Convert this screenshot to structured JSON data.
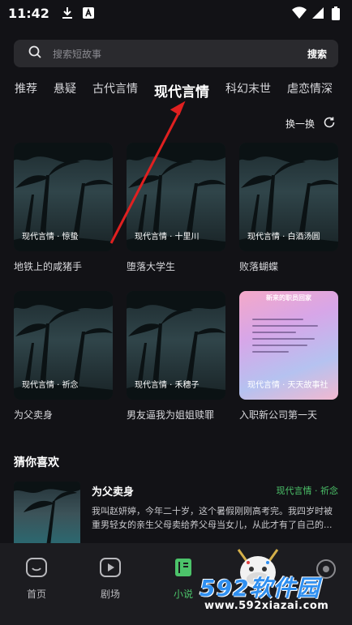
{
  "status": {
    "time": "11:42",
    "left_icons": [
      "download-icon",
      "app-a-icon"
    ],
    "right_icons": [
      "wifi-icon",
      "signal-icon",
      "battery-icon"
    ]
  },
  "search": {
    "placeholder": "搜索短故事",
    "button": "搜索"
  },
  "tabs": [
    {
      "label": "推荐",
      "active": false
    },
    {
      "label": "悬疑",
      "active": false
    },
    {
      "label": "古代言情",
      "active": false
    },
    {
      "label": "现代言情",
      "active": true
    },
    {
      "label": "科幻末世",
      "active": false
    },
    {
      "label": "虐恋情深",
      "active": false
    }
  ],
  "refresh_label": "换一换",
  "grid": [
    {
      "tag": "现代言情 · 惊蛰",
      "title": "地铁上的咸猪手"
    },
    {
      "tag": "现代言情 · 十里川",
      "title": "堕落大学生"
    },
    {
      "tag": "现代言情 · 白酒汤圆",
      "title": "败落蝴蝶"
    },
    {
      "tag": "现代言情 · 祈念",
      "title": "为父卖身"
    },
    {
      "tag": "现代言情 · 禾穗子",
      "title": "男友逼我为姐姐赎罪"
    },
    {
      "tag": "现代言情 · 天天故事社",
      "title": "入职新公司第一天",
      "cover_heading": "新来的职员回家"
    }
  ],
  "guess": {
    "section_title": "猜你喜欢",
    "item": {
      "title": "为父卖身",
      "tag": "现代言情 · 祈念",
      "desc": "我叫赵妍婷，今年二十岁，这个暑假刚刚高考完。我四岁时被重男轻女的亲生父母卖给养父母当女儿，从此才有了自己的..."
    }
  },
  "bottom_nav": [
    {
      "label": "首页",
      "icon": "home-icon",
      "active": false
    },
    {
      "label": "剧场",
      "icon": "play-icon",
      "active": false
    },
    {
      "label": "小说",
      "icon": "book-icon",
      "active": true
    }
  ],
  "watermark": {
    "brand": "592软件园",
    "url": "www.592xiazai.com"
  },
  "colors": {
    "background": "#121216",
    "accent_green": "#4cc36a",
    "arrow_red": "#e02020",
    "watermark_blue": "#2f8ff0"
  }
}
